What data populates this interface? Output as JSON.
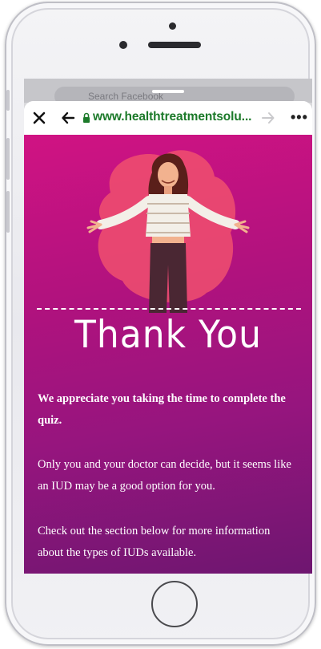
{
  "browser": {
    "url": "www.healthtreatmentsolu...",
    "behind_search_placeholder": "Search Facebook"
  },
  "page": {
    "heading": "Thank You",
    "paragraph_bold": "We appreciate you taking the time to complete the quiz.",
    "paragraph_2": "Only you and your doctor can decide, but it seems like an IUD may be a good option for you.",
    "paragraph_3": "Check out the section below for more information about the types of IUDs available."
  },
  "colors": {
    "gradient_top": "#d01383",
    "gradient_bottom": "#6e1670",
    "url_green": "#1c7a2a"
  },
  "icons": [
    "close-icon",
    "back-arrow-icon",
    "lock-icon",
    "forward-arrow-icon",
    "more-icon"
  ]
}
